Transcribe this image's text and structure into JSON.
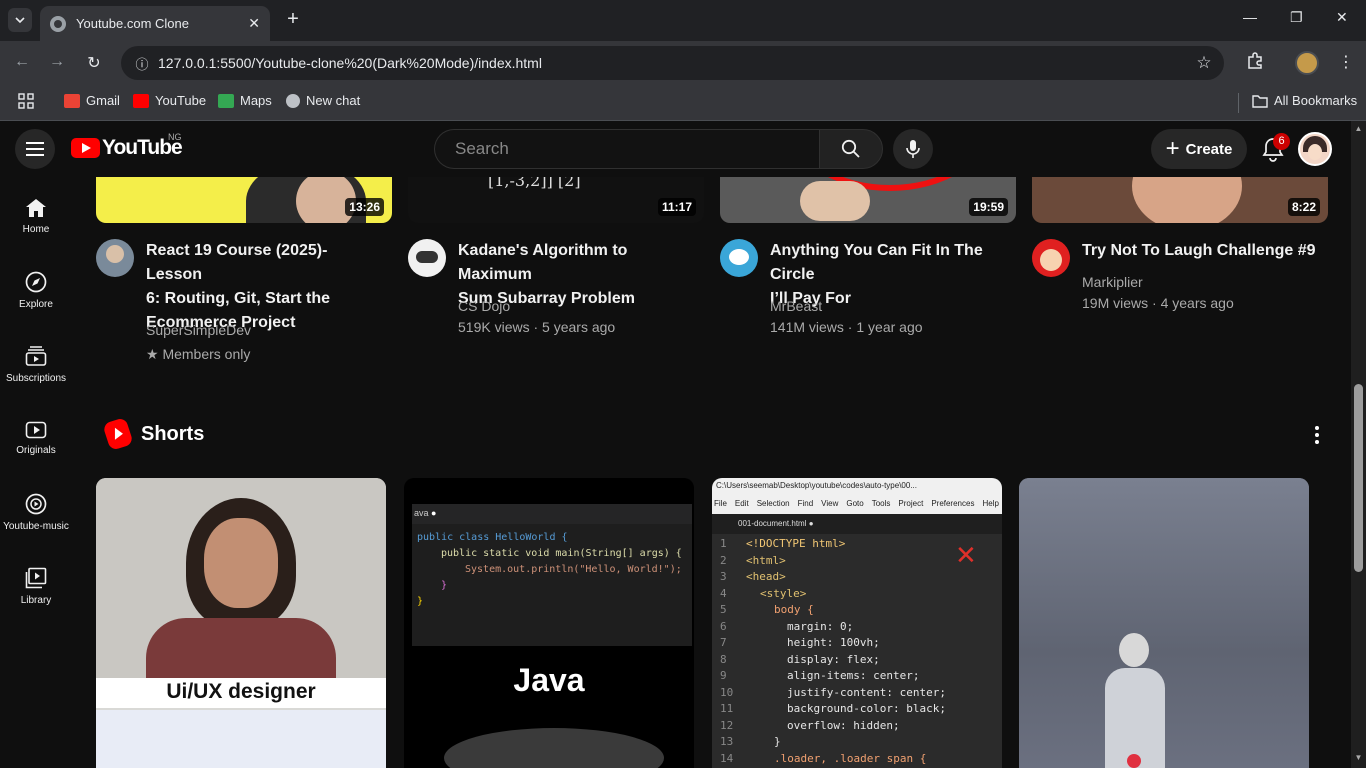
{
  "browser": {
    "tab_title": "Youtube.com Clone",
    "url": "127.0.0.1:5500/Youtube-clone%20(Dark%20Mode)/index.html",
    "bookmarks": [
      {
        "label": "Gmail",
        "color": "#ea4335"
      },
      {
        "label": "YouTube",
        "color": "#ff0000"
      },
      {
        "label": "Maps",
        "color": "#34a853"
      },
      {
        "label": "New chat",
        "color": "#bdc1c6"
      }
    ],
    "all_bookmarks": "All Bookmarks"
  },
  "header": {
    "logo_text": "YouTube",
    "country_code": "NG",
    "search_placeholder": "Search",
    "create_label": "Create",
    "notification_count": "6"
  },
  "sidebar": {
    "items": [
      {
        "label": "Home",
        "icon": "home-icon"
      },
      {
        "label": "Explore",
        "icon": "compass-icon"
      },
      {
        "label": "Subscriptions",
        "icon": "subscriptions-icon"
      },
      {
        "label": "Originals",
        "icon": "originals-icon"
      },
      {
        "label": "Youtube-music",
        "icon": "music-icon"
      },
      {
        "label": "Library",
        "icon": "library-icon"
      }
    ]
  },
  "videos": [
    {
      "title_line1": "React 19 Course (2025)- Lesson",
      "title_line2": "6: Routing, Git, Start the",
      "title_line3": "Ecommerce Project",
      "channel": "SuperSimpleDev",
      "meta": "★ Members only",
      "duration": "13:26"
    },
    {
      "title_line1": "Kadane's Algorithm to Maximum",
      "title_line2": "Sum Subarray Problem",
      "channel": "CS Dojo",
      "meta": "519K views · 5 years ago",
      "duration": "11:17"
    },
    {
      "title_line1": "Anything You Can Fit In The Circle",
      "title_line2": "I’ll Pay For",
      "channel": "MrBeast",
      "meta": "141M views · 1 year ago",
      "duration": "19:59"
    },
    {
      "title_line1": "Try Not To Laugh Challenge #9",
      "channel": "Markiplier",
      "meta": "19M views · 4 years ago",
      "duration": "8:22"
    }
  ],
  "shorts": {
    "title": "Shorts",
    "items": [
      {
        "caption": "Ui/UX designer"
      },
      {
        "caption": "Java",
        "code_tab": "ava",
        "code_lines": [
          "public class HelloWorld {",
          "public static void main(String[] args) {",
          "System.out.println(\"Hello, World!\");",
          "}",
          "}"
        ]
      },
      {
        "window_title": "C:\\Users\\seemab\\Desktop\\youtube\\codes\\auto-type\\00...",
        "menu": [
          "File",
          "Edit",
          "Selection",
          "Find",
          "View",
          "Goto",
          "Tools",
          "Project",
          "Preferences",
          "Help"
        ],
        "file_tab": "001-document.html",
        "code_lines": [
          "<!DOCTYPE html>",
          "<html>",
          "<head>",
          "<style>",
          "body {",
          "margin: 0;",
          "height: 100vh;",
          "display: flex;",
          "align-items: center;",
          "justify-content: center;",
          "background-color: black;",
          "overflow: hidden;",
          "}",
          ".loader, .loader span {"
        ]
      },
      {
        "caption": ""
      }
    ]
  },
  "colors": {
    "accent": "#ff0000",
    "background": "#0f0f0f",
    "chrome": "#35363a"
  }
}
